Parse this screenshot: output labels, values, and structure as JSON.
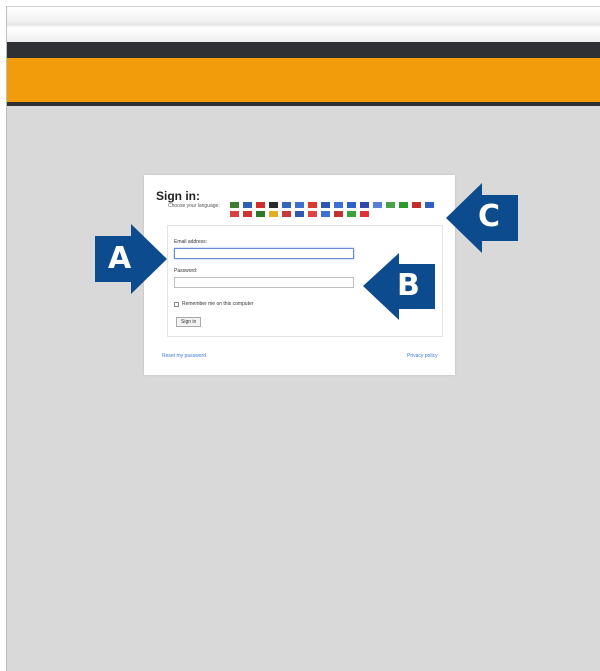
{
  "header": {
    "colors": {
      "dark": "#2f3033",
      "orange": "#f29b0b",
      "background": "#d9d9d9"
    }
  },
  "signin": {
    "title": "Sign in:",
    "language_label": "Choose your language:",
    "flags": [
      {
        "name": "flag-1",
        "color": "#3b7d2c"
      },
      {
        "name": "flag-2",
        "color": "#2f5fb5"
      },
      {
        "name": "flag-3",
        "color": "#d12b2b"
      },
      {
        "name": "flag-4",
        "color": "#2a2a2a"
      },
      {
        "name": "flag-5",
        "color": "#3367b8"
      },
      {
        "name": "flag-6",
        "color": "#3c6fcf"
      },
      {
        "name": "flag-7",
        "color": "#d83b2b"
      },
      {
        "name": "flag-8",
        "color": "#2d56b3"
      },
      {
        "name": "flag-9",
        "color": "#3b6fd2"
      },
      {
        "name": "flag-10",
        "color": "#2b63c4"
      },
      {
        "name": "flag-11",
        "color": "#2f47a8"
      },
      {
        "name": "flag-12",
        "color": "#5a7fd8"
      },
      {
        "name": "flag-13",
        "color": "#4aa34a"
      },
      {
        "name": "flag-14",
        "color": "#2b9a2b"
      },
      {
        "name": "flag-15",
        "color": "#c72c2c"
      },
      {
        "name": "flag-16",
        "color": "#2f5fbf"
      },
      {
        "name": "flag-17",
        "color": "#d94040"
      },
      {
        "name": "flag-18",
        "color": "#cc3333"
      },
      {
        "name": "flag-19",
        "color": "#2a7a2a"
      },
      {
        "name": "flag-20",
        "color": "#e0b020"
      },
      {
        "name": "flag-21",
        "color": "#c83a3a"
      },
      {
        "name": "flag-22",
        "color": "#2f58b0"
      },
      {
        "name": "flag-23",
        "color": "#d44"
      },
      {
        "name": "flag-24",
        "color": "#3d6fd0"
      },
      {
        "name": "flag-25",
        "color": "#c23232"
      },
      {
        "name": "flag-26",
        "color": "#3aa23a"
      },
      {
        "name": "flag-27",
        "color": "#d33"
      }
    ],
    "email_label": "Email address:",
    "email_value": "",
    "password_label": "Password:",
    "password_value": "",
    "remember_label": "Remember me on this computer",
    "signin_button": "Sign in",
    "reset_link": "Reset my password",
    "privacy_link": "Privacy policy"
  },
  "callouts": {
    "a": "A",
    "b": "B",
    "c": "C",
    "color": "#0d4b8f"
  }
}
